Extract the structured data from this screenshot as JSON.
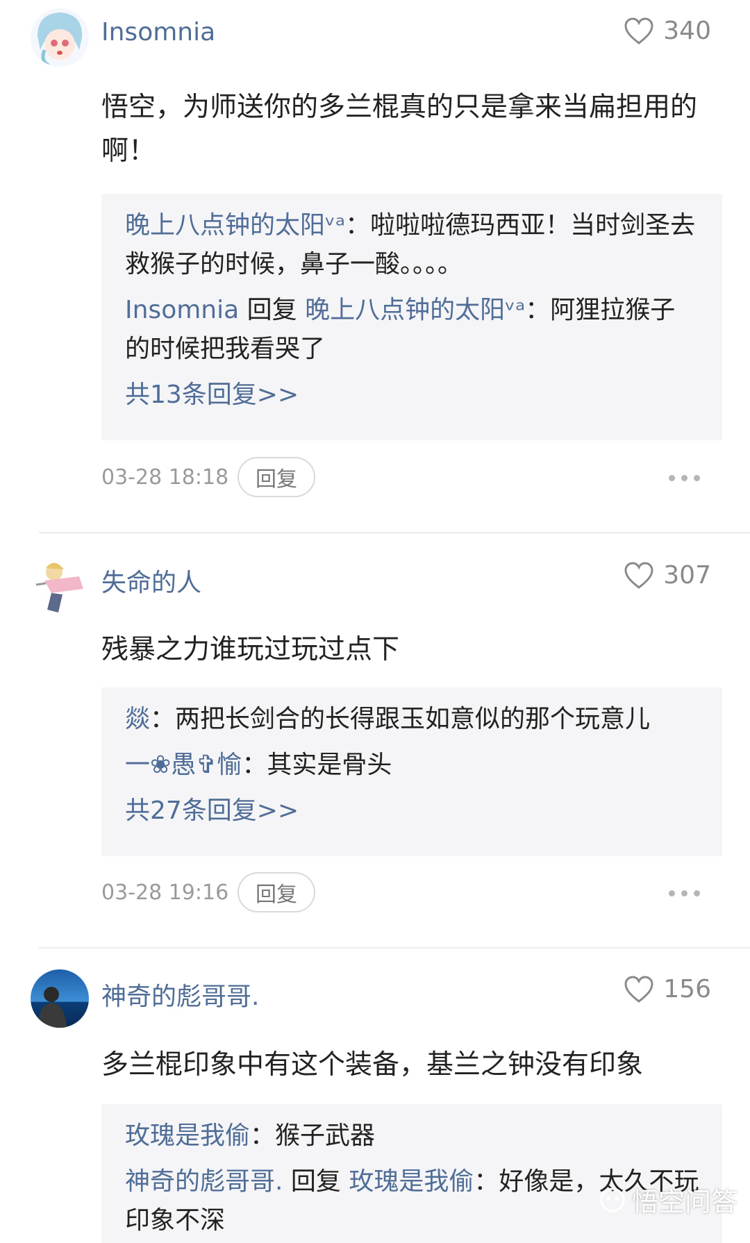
{
  "comments": [
    {
      "username": "Insomnia",
      "likes": "340",
      "content": "悟空，为师送你的多兰棍真的只是拿来当扁担用的啊！",
      "replies": [
        {
          "name": "晚上八点钟的太阳ᵛᵃ",
          "text": "啦啦啦德玛西亚！当时剑圣去救猴子的时候，鼻子一酸。。。。"
        },
        {
          "name": "Insomnia",
          "reply_word": "回复",
          "target": "晚上八点钟的太阳ᵛᵃ",
          "text": "阿狸拉猴子的时候把我看哭了"
        }
      ],
      "more": "共13条回复>>",
      "time": "03-28 18:18",
      "reply_button": "回复"
    },
    {
      "username": "失命的人",
      "likes": "307",
      "content": "残暴之力谁玩过玩过点下",
      "replies": [
        {
          "name": "燚",
          "text": "两把长剑合的长得跟玉如意似的那个玩意儿"
        },
        {
          "name": "一❀愚✞愉",
          "text": "其实是骨头"
        }
      ],
      "more": "共27条回复>>",
      "time": "03-28 19:16",
      "reply_button": "回复"
    },
    {
      "username": "神奇的彪哥哥.",
      "likes": "156",
      "content": "多兰棍印象中有这个装备，基兰之钟没有印象",
      "replies": [
        {
          "name": "玫瑰是我偷",
          "text": "猴子武器"
        },
        {
          "name": "神奇的彪哥哥.",
          "reply_word": "回复",
          "target": "玫瑰是我偷",
          "text": "好像是，太久不玩印象不深"
        }
      ]
    }
  ],
  "separator": "：",
  "watermark": "悟空问答",
  "colors": {
    "name_blue": "#4f6d97",
    "reply_bg": "#f5f5f7",
    "meta_gray": "#9a9a9a"
  },
  "icons": [
    "heart-outline-icon",
    "more-dots-icon",
    "wukong-logo-icon"
  ]
}
